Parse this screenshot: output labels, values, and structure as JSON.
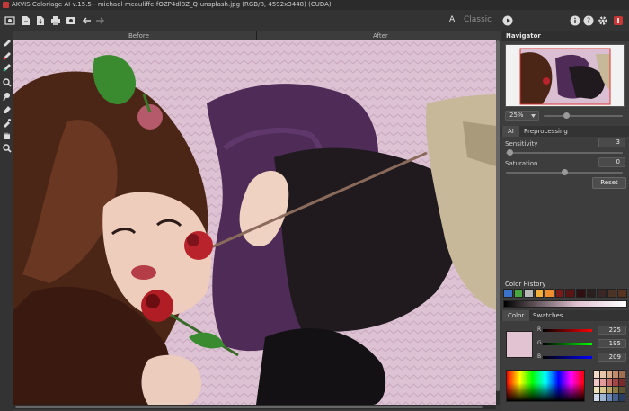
{
  "title": "AKVIS Coloriage AI v.15.5 - michael-mcauliffe-fOZP4dl8Z_Q-unsplash.jpg (RGB/8, 4592x3448) (CUDA)",
  "toolbar": {
    "mode_ai": "AI",
    "mode_classic": "Classic",
    "icons": [
      "home-icon",
      "open-file-icon",
      "save-icon",
      "print-icon",
      "batch-icon",
      "undo-icon",
      "redo-icon",
      "run-icon",
      "info-icon",
      "help-icon",
      "settings-icon",
      "about-icon"
    ]
  },
  "canvas": {
    "before_label": "Before",
    "after_label": "After"
  },
  "navigator": {
    "title": "Navigator",
    "zoom": "25%"
  },
  "settings": {
    "tabs": [
      "AI",
      "Preprocessing"
    ],
    "sensitivity_label": "Sensitivity",
    "sensitivity_value": "3",
    "saturation_label": "Saturation",
    "saturation_value": "0",
    "reset_label": "Reset"
  },
  "color_history": {
    "title": "Color History",
    "colors": [
      "#3a73c9",
      "#46a83f",
      "#b9b9b9",
      "#f2b03a",
      "#ef8e2e",
      "#7a1a1a",
      "#5a1414",
      "#2f0f12",
      "#2b2020",
      "#3b2826",
      "#4a3224",
      "#58331f"
    ]
  },
  "color": {
    "tabs": [
      "Color",
      "Swatches"
    ],
    "current": "#e1c3d1",
    "r_label": "R",
    "g_label": "G",
    "b_label": "B",
    "r": "225",
    "g": "195",
    "b": "209"
  }
}
